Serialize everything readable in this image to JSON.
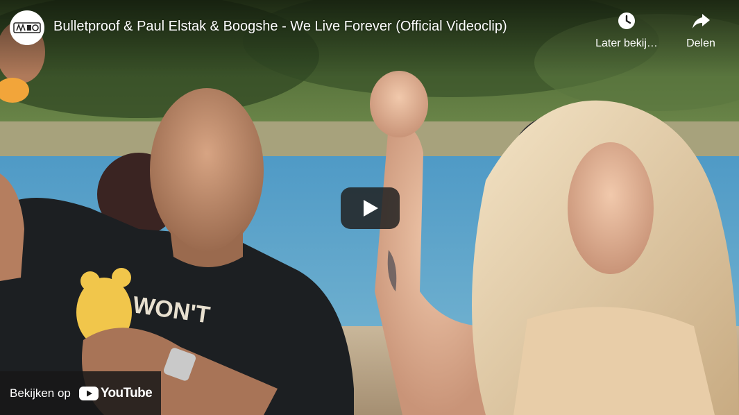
{
  "video": {
    "title": "Bulletproof & Paul Elstak & Boogshe - We Live Forever (Official Videoclip)"
  },
  "channel": {
    "avatar_icon": "channel-logo-icon"
  },
  "actions": {
    "watch_later_label": "Later bekij…",
    "watch_later_icon": "clock-icon",
    "share_label": "Delen",
    "share_icon": "share-arrow-icon"
  },
  "player": {
    "play_icon": "play-icon"
  },
  "watch_on": {
    "label": "Bekijken op",
    "brand_word": "YouTube",
    "brand_icon": "youtube-logo-icon"
  },
  "colors": {
    "brand_red": "#ff0000",
    "overlay": "#171717"
  }
}
